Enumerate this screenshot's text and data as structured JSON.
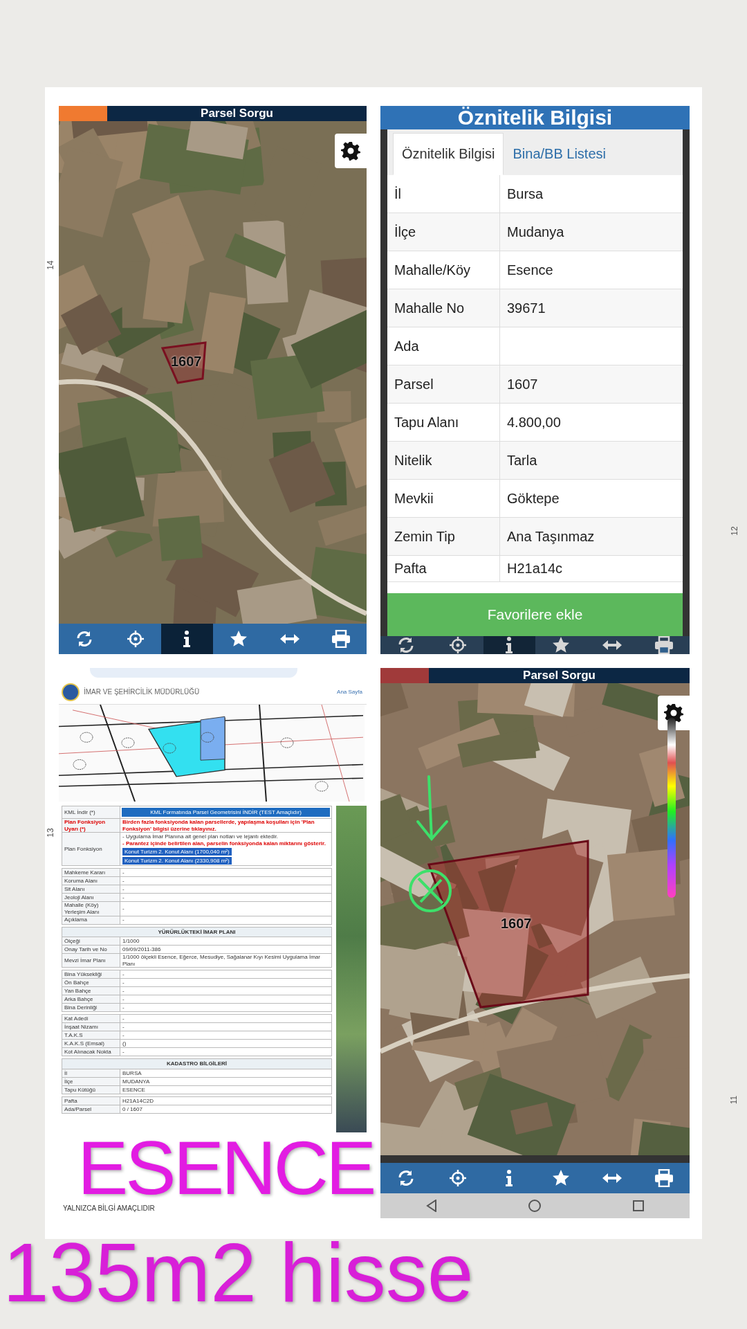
{
  "edge_marks": [
    "14",
    "13",
    "12",
    "11"
  ],
  "top_left": {
    "title": "Parsel Sorgu",
    "parcel_label": "1607",
    "toolbar": [
      {
        "kind": "refresh",
        "selected": false
      },
      {
        "kind": "locate",
        "selected": false
      },
      {
        "kind": "info",
        "selected": true
      },
      {
        "kind": "star",
        "selected": false
      },
      {
        "kind": "measure",
        "selected": false
      },
      {
        "kind": "print",
        "selected": false
      }
    ]
  },
  "top_right": {
    "title": "Öznitelik Bilgisi",
    "tabs": [
      {
        "label": "Öznitelik Bilgisi",
        "selected": true
      },
      {
        "label": "Bina/BB Listesi",
        "selected": false
      }
    ],
    "rows": [
      {
        "label": "İl",
        "value": "Bursa"
      },
      {
        "label": "İlçe",
        "value": "Mudanya"
      },
      {
        "label": "Mahalle/Köy",
        "value": "Esence"
      },
      {
        "label": "Mahalle No",
        "value": "39671"
      },
      {
        "label": "Ada"
      },
      {
        "label": "Parsel",
        "value": "1607"
      },
      {
        "label": "Tapu Alanı",
        "value": "4.800,00"
      },
      {
        "label": "Nitelik",
        "value": "Tarla"
      },
      {
        "label": "Mevkii",
        "value": "Göktepe"
      },
      {
        "label": "Zemin Tip",
        "value": "Ana Taşınmaz"
      },
      {
        "label": "Pafta",
        "value": "H21a14c"
      }
    ],
    "button": "Favorilere ekle",
    "toolbar": [
      {
        "kind": "refresh",
        "selected": false
      },
      {
        "kind": "locate",
        "selected": false
      },
      {
        "kind": "info",
        "selected": true
      },
      {
        "kind": "star",
        "selected": false
      },
      {
        "kind": "measure",
        "selected": false
      },
      {
        "kind": "print",
        "selected": false
      }
    ]
  },
  "document": {
    "department": "İMAR VE ŞEHİRCİLİK MÜDÜRLÜĞÜ",
    "nav_link": "Ana Sayfa",
    "kml_label": "KML İndir (*)",
    "kml_button": "KML Formatında Parsel Geometrisini İNDİR (TEST Amaçlıdır)",
    "warning_label": "Plan Fonksiyon Uyarı (*)",
    "warning": "Birden fazla fonksiyonda kalan parsellerde, yapılaşma koşulları için 'Plan Fonksiyon' bilgisi üzerine tıklayınız.",
    "function_label": "Plan Fonksiyon",
    "function_note": "- Uygulama İmar Planına ait genel plan notları ve lejantı ektedir.",
    "function_hint": "- Parantez içinde belirtilen alan, parselin fonksiyonda kalan miktarını gösterir.",
    "function_buttons": [
      "Konut Turizm 2. Konut Alanı (1700,040 m²)",
      "Konut Turizm 2. Konut Alanı (2330,908 m²)"
    ],
    "sections": [
      {
        "rows": [
          {
            "label": "Mahkeme Kararı",
            "value": "-"
          },
          {
            "label": "Koruma Alanı",
            "value": "-"
          },
          {
            "label": "Sit Alanı",
            "value": "-"
          },
          {
            "label": "Jeoloji Alanı",
            "value": "-"
          },
          {
            "label": "Mahalle (Köy) Yerleşim Alanı",
            "value": "-"
          },
          {
            "label": "Açıklama",
            "value": "-"
          }
        ]
      },
      {
        "title": "YÜRÜRLÜKTEKİ İMAR PLANI",
        "rows": [
          {
            "label": "Ölçeği",
            "value": "1/1000"
          },
          {
            "label": "Onay Tarih ve No",
            "value": "09/09/2011-386"
          },
          {
            "label": "Mevzi İmar Planı",
            "value": "1/1000 ölçekli Esence, Eğerce, Mesudiye, Sağalanar Kıyı Kesimi Uygulama İmar Planı"
          }
        ]
      },
      {
        "rows": [
          {
            "label": "Bina Yüksekliği",
            "value": "-"
          },
          {
            "label": "Ön Bahçe",
            "value": "-"
          },
          {
            "label": "Yan Bahçe",
            "value": "-"
          },
          {
            "label": "Arka Bahçe",
            "value": "-"
          },
          {
            "label": "Bina Derinliği",
            "value": "-"
          }
        ]
      },
      {
        "rows": [
          {
            "label": "Kat Adedi",
            "value": "-"
          },
          {
            "label": "İnşaat Nizamı",
            "value": "-"
          },
          {
            "label": "T.A.K.S",
            "value": "-"
          },
          {
            "label": "K.A.K.S (Emsal)",
            "value": "()"
          },
          {
            "label": "Kot Alınacak Nokta",
            "value": "-"
          }
        ]
      },
      {
        "title": "KADASTRO BİLGİLERİ",
        "rows": [
          {
            "label": "İl",
            "value": "BURSA"
          },
          {
            "label": "İlçe",
            "value": "MUDANYA"
          },
          {
            "label": "Tapu Kütüğü",
            "value": "ESENCE"
          }
        ]
      },
      {
        "rows": [
          {
            "label": "Pafta",
            "value": "H21A14C2D"
          },
          {
            "label": "Ada/Parsel",
            "value": "0 / 1607"
          }
        ]
      }
    ],
    "footer": "YALNIZCA BİLGİ AMAÇLIDIR"
  },
  "bottom_right": {
    "title": "Parsel Sorgu",
    "parcel_label": "1607",
    "toolbar": [
      {
        "kind": "refresh",
        "selected": false
      },
      {
        "kind": "locate",
        "selected": false
      },
      {
        "kind": "info",
        "selected": false
      },
      {
        "kind": "star",
        "selected": false
      },
      {
        "kind": "measure",
        "selected": false
      },
      {
        "kind": "print",
        "selected": false
      }
    ]
  },
  "overlay": {
    "place": "ESENCE",
    "caption": "135m2 hisse"
  }
}
